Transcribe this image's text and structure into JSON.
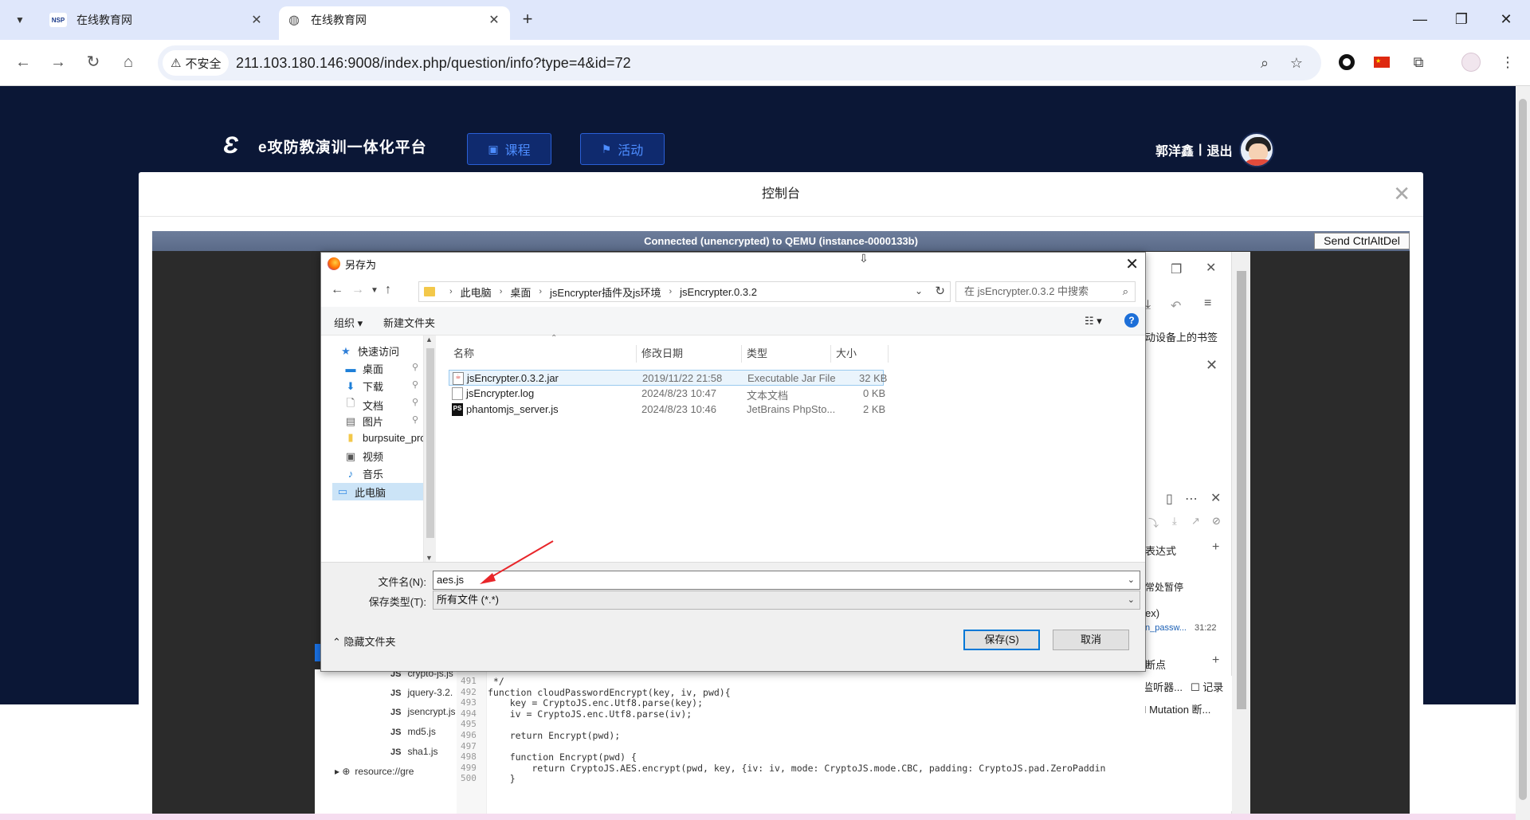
{
  "browser": {
    "tabs": [
      {
        "title": "在线教育网",
        "favicon": "NSP",
        "active": false
      },
      {
        "title": "在线教育网",
        "favicon": "globe-icon",
        "active": true
      }
    ],
    "security_label": "不安全",
    "url": "211.103.180.146:9008/index.php/question/info?type=4&id=72"
  },
  "site": {
    "logo_text": "e攻防教演训一体化平台",
    "nav": [
      {
        "label": "课程",
        "icon": "book-icon"
      },
      {
        "label": "活动",
        "icon": "flag-icon"
      }
    ],
    "user": {
      "name": "郭洋鑫",
      "separator": "|",
      "logout": "退出"
    }
  },
  "modal": {
    "title": "控制台",
    "vnc_status": "Connected (unencrypted) to QEMU (instance-0000133b)",
    "vnc_button": "Send CtrlAltDel"
  },
  "remote": {
    "right_panel": {
      "bookmark_text": "动设备上的书签",
      "expressions": "表达式",
      "pause_on_exceptions": "常处暂停",
      "scope_text": "ex)",
      "watch_item": "n_passw...",
      "watch_line": "31:22",
      "breakpoints": "断点",
      "event_listeners": "事件监听器...",
      "record": "记录",
      "dom_mutation": "DOM Mutation 断..."
    },
    "tree": [
      {
        "label": "crypto-js.js"
      },
      {
        "label": "jquery-3.2."
      },
      {
        "label": "jsencrypt.js"
      },
      {
        "label": "md5.js"
      },
      {
        "label": "sha1.js"
      },
      {
        "label": "resource://gre"
      }
    ],
    "code_lines": [
      {
        "n": "491",
        "t": " */"
      },
      {
        "n": "492",
        "t": "function cloudPasswordEncrypt(key, iv, pwd){"
      },
      {
        "n": "493",
        "t": "    key = CryptoJS.enc.Utf8.parse(key);"
      },
      {
        "n": "494",
        "t": "    iv = CryptoJS.enc.Utf8.parse(iv);"
      },
      {
        "n": "495",
        "t": ""
      },
      {
        "n": "496",
        "t": "    return Encrypt(pwd);"
      },
      {
        "n": "497",
        "t": ""
      },
      {
        "n": "498",
        "t": "    function Encrypt(pwd) {"
      },
      {
        "n": "499",
        "t": "        return CryptoJS.AES.encrypt(pwd, key, {iv: iv, mode: CryptoJS.mode.CBC, padding: CryptoJS.pad.ZeroPaddin"
      },
      {
        "n": "500",
        "t": "    }"
      }
    ]
  },
  "dialog": {
    "title": "另存为",
    "breadcrumb": [
      "此电脑",
      "桌面",
      "jsEncrypter插件及js环境",
      "jsEncrypter.0.3.2"
    ],
    "search_placeholder": "在 jsEncrypter.0.3.2 中搜索",
    "organize": "组织",
    "new_folder": "新建文件夹",
    "nav_items": [
      {
        "label": "快速访问",
        "icon": "star-icon"
      },
      {
        "label": "桌面",
        "icon": "desktop-icon",
        "pinned": true
      },
      {
        "label": "下载",
        "icon": "download-icon",
        "pinned": true
      },
      {
        "label": "文档",
        "icon": "document-icon",
        "pinned": true
      },
      {
        "label": "图片",
        "icon": "picture-icon",
        "pinned": true
      },
      {
        "label": "burpsuite_pro_",
        "icon": "folder-icon"
      },
      {
        "label": "视频",
        "icon": "video-icon"
      },
      {
        "label": "音乐",
        "icon": "music-icon"
      },
      {
        "label": "此电脑",
        "icon": "computer-icon"
      }
    ],
    "columns": {
      "name": "名称",
      "date": "修改日期",
      "type": "类型",
      "size": "大小"
    },
    "files": [
      {
        "name": "jsEncrypter.0.3.2.jar",
        "date": "2019/11/22 21:58",
        "type": "Executable Jar File",
        "size": "32 KB",
        "icon": "jar-file-icon"
      },
      {
        "name": "jsEncrypter.log",
        "date": "2024/8/23 10:47",
        "type": "文本文档",
        "size": "0 KB",
        "icon": "text-file-icon"
      },
      {
        "name": "phantomjs_server.js",
        "date": "2024/8/23 10:46",
        "type": "JetBrains PhpSto...",
        "size": "2 KB",
        "icon": "phpstorm-file-icon"
      }
    ],
    "filename_label": "文件名(N):",
    "filename_value": "aes.js",
    "filetype_label": "保存类型(T):",
    "filetype_value": "所有文件 (*.*)",
    "hide_folders": "隐藏文件夹",
    "save": "保存(S)",
    "cancel": "取消"
  },
  "colors": {
    "page_dark": "#0b1736",
    "nav_accent": "#4d8dff",
    "annotation_arrow": "#e8262a",
    "dialog_default_border": "#0078d7"
  }
}
